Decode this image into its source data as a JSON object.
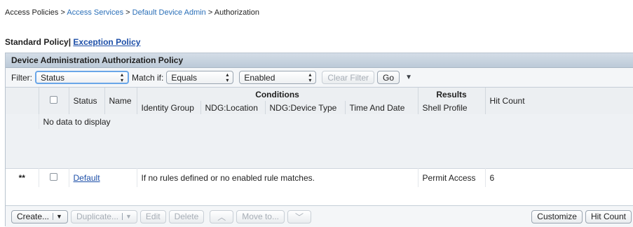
{
  "breadcrumb": {
    "item1": "Access Policies",
    "sep": ">",
    "item2": "Access Services",
    "item3": "Default Device Admin",
    "item4": "Authorization"
  },
  "policy_tabs": {
    "standard": "Standard Policy|",
    "exception": "Exception Policy"
  },
  "panel": {
    "title": "Device Administration Authorization Policy"
  },
  "filter": {
    "label": "Filter:",
    "field_value": "Status",
    "match_label": "Match if:",
    "operator_value": "Equals",
    "value_value": "Enabled",
    "clear_label": "Clear Filter",
    "go_label": "Go",
    "more_icon": "triangle-down-icon"
  },
  "table": {
    "headers": {
      "status": "Status",
      "name": "Name",
      "conditions": "Conditions",
      "identity_group": "Identity Group",
      "ndg_location": "NDG:Location",
      "ndg_device_type": "NDG:Device Type",
      "time_and_date": "Time And Date",
      "results": "Results",
      "shell_profile": "Shell Profile",
      "hit_count": "Hit Count"
    },
    "empty_text": "No data to display",
    "default_row": {
      "marker": "**",
      "name": "Default",
      "condition_text": "If no rules defined or no enabled rule matches.",
      "shell_profile": "Permit Access",
      "hit_count": "6"
    }
  },
  "bottom_bar": {
    "create": "Create...",
    "duplicate": "Duplicate...",
    "edit": "Edit",
    "delete": "Delete",
    "move_up_icon": "chevron-up-icon",
    "move_to": "Move to...",
    "move_down_icon": "chevron-down-icon",
    "customize": "Customize",
    "hit_count": "Hit Count"
  },
  "colors": {
    "link": "#2a6fb8",
    "panel_header": "#c9d4df"
  }
}
